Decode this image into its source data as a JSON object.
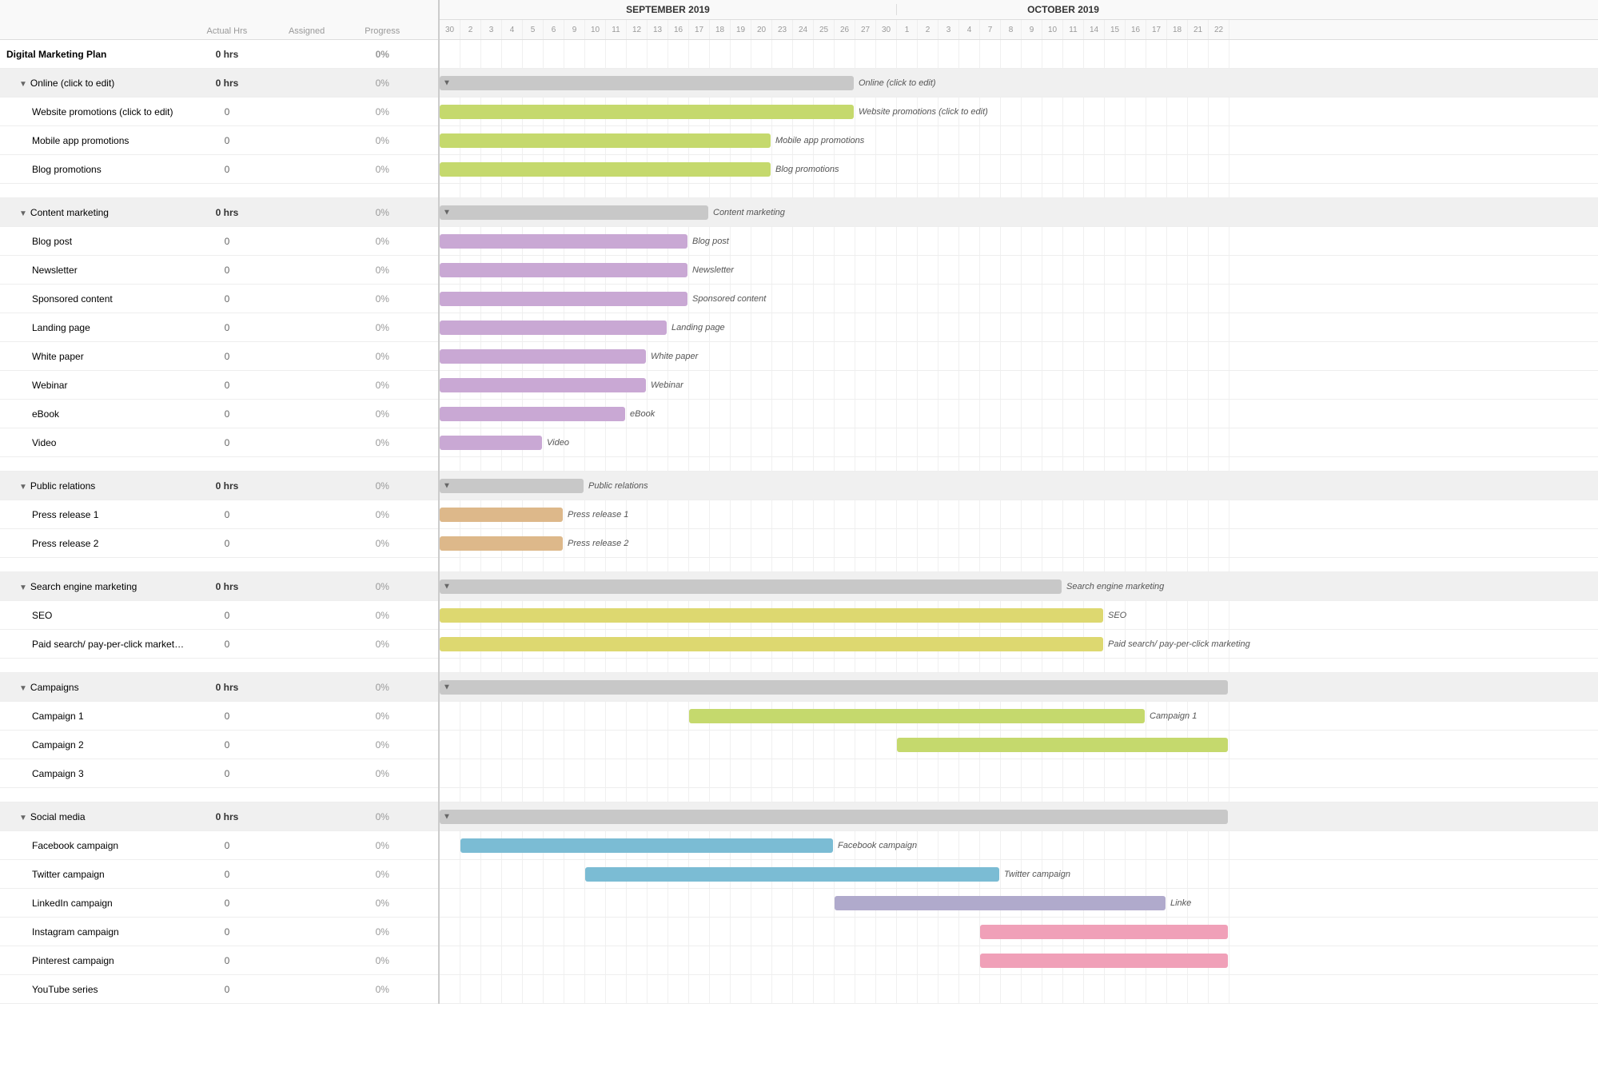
{
  "columns": {
    "task": "",
    "actual": "Actual Hrs",
    "assigned": "Assigned",
    "progress": "Progress"
  },
  "rows": [
    {
      "id": "main",
      "label": "Digital Marketing Plan",
      "actual": "0 hrs",
      "assigned": "",
      "progress": "0%",
      "type": "main-header",
      "indent": 0
    },
    {
      "id": "online",
      "label": "Online (click to edit)",
      "actual": "0 hrs",
      "assigned": "",
      "progress": "0%",
      "type": "group-header",
      "indent": 1,
      "arrow": true
    },
    {
      "id": "website",
      "label": "Website promotions (click to edit)",
      "actual": "0",
      "assigned": "",
      "progress": "0%",
      "type": "task",
      "indent": 2
    },
    {
      "id": "mobile",
      "label": "Mobile app promotions",
      "actual": "0",
      "assigned": "",
      "progress": "0%",
      "type": "task",
      "indent": 2
    },
    {
      "id": "blog",
      "label": "Blog promotions",
      "actual": "0",
      "assigned": "",
      "progress": "0%",
      "type": "task",
      "indent": 2
    },
    {
      "id": "spacer1",
      "label": "",
      "actual": "",
      "assigned": "",
      "progress": "",
      "type": "spacer"
    },
    {
      "id": "content",
      "label": "Content marketing",
      "actual": "0 hrs",
      "assigned": "",
      "progress": "0%",
      "type": "group-header",
      "indent": 1,
      "arrow": true
    },
    {
      "id": "blogpost",
      "label": "Blog post",
      "actual": "0",
      "assigned": "",
      "progress": "0%",
      "type": "task",
      "indent": 2
    },
    {
      "id": "newsletter",
      "label": "Newsletter",
      "actual": "0",
      "assigned": "",
      "progress": "0%",
      "type": "task",
      "indent": 2
    },
    {
      "id": "sponsored",
      "label": "Sponsored content",
      "actual": "0",
      "assigned": "",
      "progress": "0%",
      "type": "task",
      "indent": 2
    },
    {
      "id": "landing",
      "label": "Landing page",
      "actual": "0",
      "assigned": "",
      "progress": "0%",
      "type": "task",
      "indent": 2
    },
    {
      "id": "whitepaper",
      "label": "White paper",
      "actual": "0",
      "assigned": "",
      "progress": "0%",
      "type": "task",
      "indent": 2
    },
    {
      "id": "webinar",
      "label": "Webinar",
      "actual": "0",
      "assigned": "",
      "progress": "0%",
      "type": "task",
      "indent": 2
    },
    {
      "id": "ebook",
      "label": "eBook",
      "actual": "0",
      "assigned": "",
      "progress": "0%",
      "type": "task",
      "indent": 2
    },
    {
      "id": "video",
      "label": "Video",
      "actual": "0",
      "assigned": "",
      "progress": "0%",
      "type": "task",
      "indent": 2
    },
    {
      "id": "spacer2",
      "label": "",
      "actual": "",
      "assigned": "",
      "progress": "",
      "type": "spacer"
    },
    {
      "id": "pr",
      "label": "Public relations",
      "actual": "0 hrs",
      "assigned": "",
      "progress": "0%",
      "type": "group-header",
      "indent": 1,
      "arrow": true
    },
    {
      "id": "press1",
      "label": "Press release 1",
      "actual": "0",
      "assigned": "",
      "progress": "0%",
      "type": "task",
      "indent": 2
    },
    {
      "id": "press2",
      "label": "Press release 2",
      "actual": "0",
      "assigned": "",
      "progress": "0%",
      "type": "task",
      "indent": 2
    },
    {
      "id": "spacer3",
      "label": "",
      "actual": "",
      "assigned": "",
      "progress": "",
      "type": "spacer"
    },
    {
      "id": "sem",
      "label": "Search engine marketing",
      "actual": "0 hrs",
      "assigned": "",
      "progress": "0%",
      "type": "group-header",
      "indent": 1,
      "arrow": true
    },
    {
      "id": "seo",
      "label": "SEO",
      "actual": "0",
      "assigned": "",
      "progress": "0%",
      "type": "task",
      "indent": 2
    },
    {
      "id": "paid",
      "label": "Paid search/ pay-per-click marketing",
      "actual": "0",
      "assigned": "",
      "progress": "0%",
      "type": "task",
      "indent": 2
    },
    {
      "id": "spacer4",
      "label": "",
      "actual": "",
      "assigned": "",
      "progress": "",
      "type": "spacer"
    },
    {
      "id": "campaigns",
      "label": "Campaigns",
      "actual": "0 hrs",
      "assigned": "",
      "progress": "0%",
      "type": "group-header",
      "indent": 1,
      "arrow": true
    },
    {
      "id": "camp1",
      "label": "Campaign 1",
      "actual": "0",
      "assigned": "",
      "progress": "0%",
      "type": "task",
      "indent": 2
    },
    {
      "id": "camp2",
      "label": "Campaign 2",
      "actual": "0",
      "assigned": "",
      "progress": "0%",
      "type": "task",
      "indent": 2
    },
    {
      "id": "camp3",
      "label": "Campaign 3",
      "actual": "0",
      "assigned": "",
      "progress": "0%",
      "type": "task",
      "indent": 2
    },
    {
      "id": "spacer5",
      "label": "",
      "actual": "",
      "assigned": "",
      "progress": "",
      "type": "spacer"
    },
    {
      "id": "social",
      "label": "Social media",
      "actual": "0 hrs",
      "assigned": "",
      "progress": "0%",
      "type": "group-header",
      "indent": 1,
      "arrow": true
    },
    {
      "id": "facebook",
      "label": "Facebook campaign",
      "actual": "0",
      "assigned": "",
      "progress": "0%",
      "type": "task",
      "indent": 2
    },
    {
      "id": "twitter",
      "label": "Twitter campaign",
      "actual": "0",
      "assigned": "",
      "progress": "0%",
      "type": "task",
      "indent": 2
    },
    {
      "id": "linkedin",
      "label": "LinkedIn campaign",
      "actual": "0",
      "assigned": "",
      "progress": "0%",
      "type": "task",
      "indent": 2
    },
    {
      "id": "instagram",
      "label": "Instagram campaign",
      "actual": "0",
      "assigned": "",
      "progress": "0%",
      "type": "task",
      "indent": 2
    },
    {
      "id": "pinterest",
      "label": "Pinterest campaign",
      "actual": "0",
      "assigned": "",
      "progress": "0%",
      "type": "task",
      "indent": 2
    },
    {
      "id": "youtube",
      "label": "YouTube series",
      "actual": "0",
      "assigned": "",
      "progress": "0%",
      "type": "task",
      "indent": 2
    }
  ],
  "months": [
    {
      "label": "SEPTEMBER 2019",
      "days": [
        "30",
        "2",
        "3",
        "4",
        "5",
        "6",
        "9",
        "10",
        "11",
        "12",
        "13",
        "16",
        "17",
        "18",
        "19",
        "20",
        "23",
        "24",
        "25",
        "26",
        "27",
        "30"
      ]
    },
    {
      "label": "OCTOBER 2019",
      "days": [
        "1",
        "2",
        "3",
        "4",
        "7",
        "8",
        "9",
        "10",
        "11",
        "14",
        "15",
        "16",
        "17",
        "18",
        "21",
        "22"
      ]
    }
  ]
}
